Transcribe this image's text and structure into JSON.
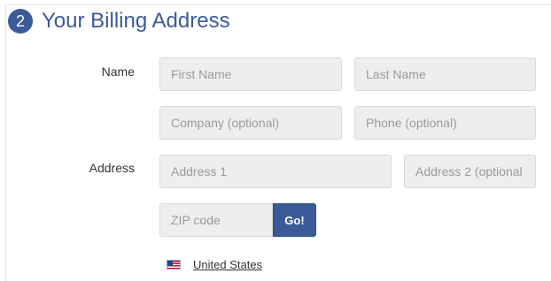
{
  "section": {
    "step_number": "2",
    "title": "Your Billing Address"
  },
  "labels": {
    "name": "Name",
    "address": "Address"
  },
  "fields": {
    "first_name": {
      "placeholder": "First Name",
      "value": ""
    },
    "last_name": {
      "placeholder": "Last Name",
      "value": ""
    },
    "company": {
      "placeholder": "Company (optional)",
      "value": ""
    },
    "phone": {
      "placeholder": "Phone (optional)",
      "value": ""
    },
    "address1": {
      "placeholder": "Address 1",
      "value": ""
    },
    "address2": {
      "placeholder": "Address 2 (optional",
      "value": ""
    },
    "zip": {
      "placeholder": "ZIP code",
      "value": ""
    }
  },
  "go_button": {
    "label": "Go!"
  },
  "country": {
    "name": "United States",
    "flag_icon": "us-flag-icon"
  },
  "colors": {
    "accent": "#3b5a98",
    "field_background": "#eeeeee",
    "placeholder": "#9a9a9a"
  }
}
